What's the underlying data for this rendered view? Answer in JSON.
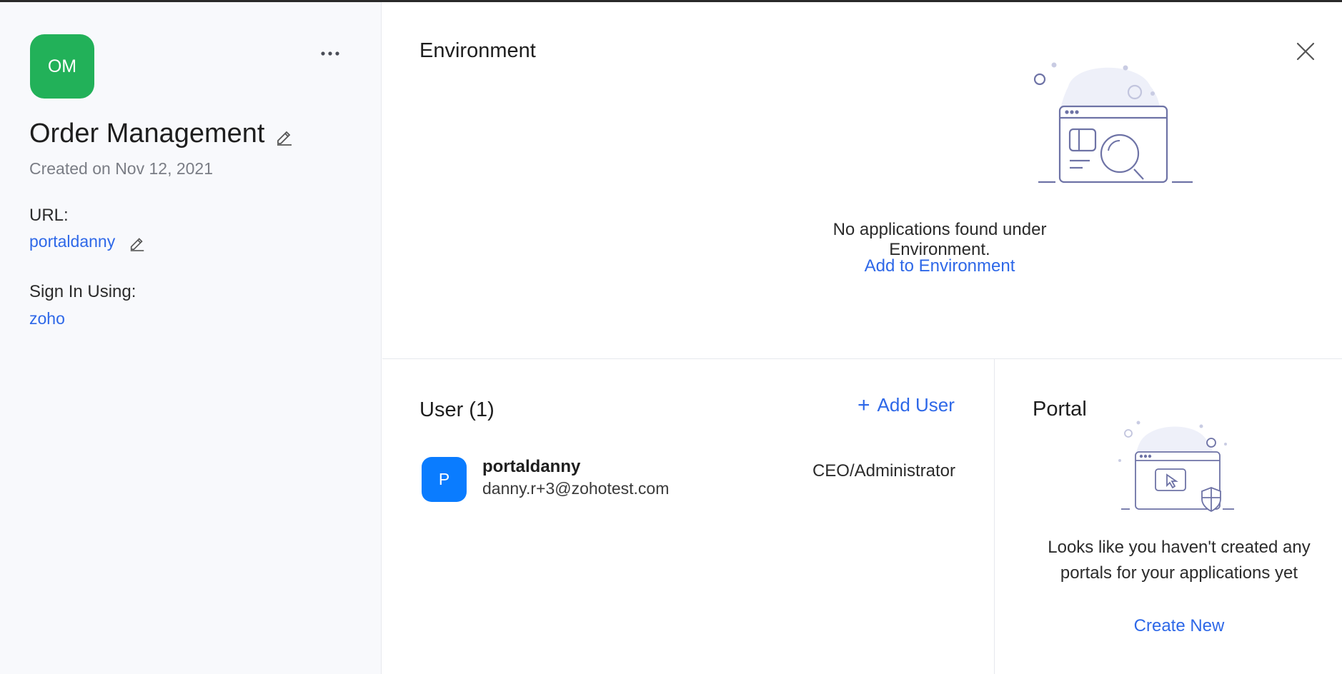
{
  "sidebar": {
    "app_initials": "OM",
    "app_title": "Order Management",
    "created_text": "Created on Nov 12, 2021",
    "url_label": "URL:",
    "url_value": "portaldanny",
    "signin_label": "Sign In Using:",
    "signin_value": "zoho",
    "icons": {
      "more": "more-horizontal-icon",
      "edit": "pencil-edit-icon"
    },
    "app_color": "#22b159"
  },
  "environment": {
    "title": "Environment",
    "empty_message": "No applications found under Environment.",
    "action_link": "Add to Environment",
    "icons": {
      "close": "close-icon",
      "illustration": "empty-environment-illustration"
    }
  },
  "users": {
    "title": "User (1)",
    "add_label": "Add User",
    "list": [
      {
        "initial": "P",
        "name": "portaldanny",
        "email": "danny.r+3@zohotest.com",
        "role": "CEO/Administrator"
      }
    ]
  },
  "portal": {
    "title": "Portal",
    "empty_line1": "Looks like you haven't created any",
    "empty_line2": "portals for your applications yet",
    "action_link": "Create New"
  },
  "colors": {
    "accent": "#2e68e8",
    "user_avatar": "#0a7cff",
    "sidebar_bg": "#f8f9fc"
  }
}
